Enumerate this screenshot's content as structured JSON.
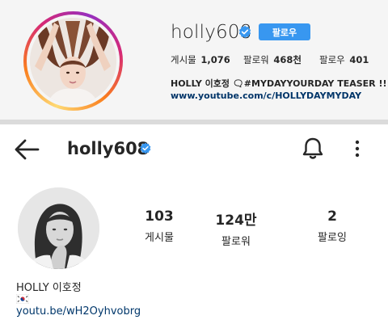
{
  "desktop_profile": {
    "username": "holly608",
    "follow_button": "팔로우",
    "stats": [
      {
        "label": "게시물",
        "value": "1,076"
      },
      {
        "label": "팔로워",
        "value": "468천"
      },
      {
        "label": "팔로우",
        "value": "401"
      }
    ],
    "bio": "HOLLY 이호정 🗨#MYDAYYOURDAY TEASER !!",
    "link": "www.youtube.com/c/HOLLYDAYMYDAY"
  },
  "mobile_profile": {
    "username": "holly608",
    "stats": [
      {
        "value": "103",
        "label": "게시물"
      },
      {
        "value": "124만",
        "label": "팔로워"
      },
      {
        "value": "2",
        "label": "팔로잉"
      }
    ],
    "name": "HOLLY 이호정",
    "link": "youtu.be/wH2Oyhvobrg"
  },
  "icons": {
    "verified": "verified-badge-icon",
    "back": "back-arrow-icon",
    "notifications": "bell-icon",
    "more": "more-vertical-icon",
    "flag": "south-korea-flag-icon"
  },
  "colors": {
    "accent": "#3897f0",
    "link_top": "#003569",
    "link_bottom": "#00376b",
    "verified": "#3897f0"
  }
}
